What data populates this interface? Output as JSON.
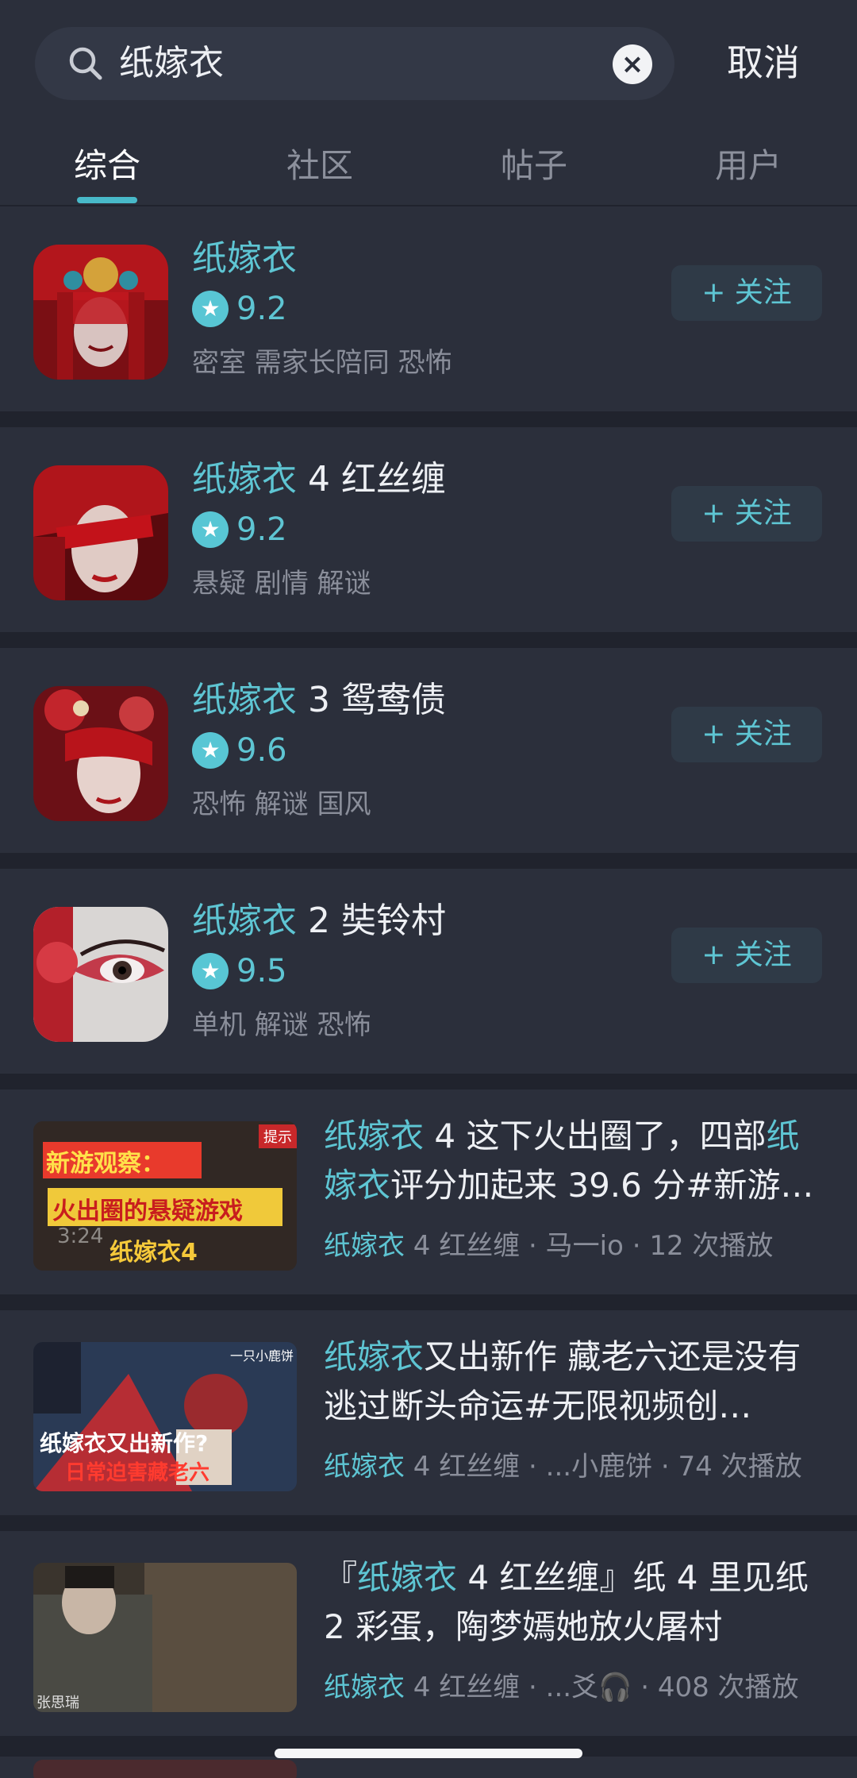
{
  "search": {
    "query": "纸嫁衣",
    "clear_icon": "close-circle-icon",
    "search_icon": "search-icon",
    "cancel_label": "取消"
  },
  "tabs": [
    {
      "label": "综合",
      "active": true
    },
    {
      "label": "社区",
      "active": false
    },
    {
      "label": "帖子",
      "active": false
    },
    {
      "label": "用户",
      "active": false
    }
  ],
  "apps": [
    {
      "title_hl": "纸嫁衣",
      "title_rest": "",
      "rating": "9.2",
      "tags": "密室 需家长陪同 恐怖",
      "follow_label": "+ 关注"
    },
    {
      "title_hl": "纸嫁衣",
      "title_rest": " 4 红丝缠",
      "rating": "9.2",
      "tags": "悬疑 剧情 解谜",
      "follow_label": "+ 关注"
    },
    {
      "title_hl": "纸嫁衣",
      "title_rest": " 3 鸳鸯债",
      "rating": "9.6",
      "tags": "恐怖 解谜 国风",
      "follow_label": "+ 关注"
    },
    {
      "title_hl": "纸嫁衣",
      "title_rest": " 2 奘铃村",
      "rating": "9.5",
      "tags": "单机 解谜 恐怖",
      "follow_label": "+ 关注"
    }
  ],
  "videos": [
    {
      "title_parts": [
        {
          "t": "纸嫁衣",
          "hl": true
        },
        {
          "t": " 4 这下火出圈了，四部",
          "hl": false
        },
        {
          "t": "纸嫁衣",
          "hl": true
        },
        {
          "t": "评分加起来 39.6 分#新游…",
          "hl": false
        }
      ],
      "meta_hl": "纸嫁衣",
      "meta_rest": " 4 红丝缠 · 马一io · 12 次播放",
      "thumb_text": [
        "新游观察：",
        "火出圈的悬疑游戏",
        "纸嫁衣4"
      ],
      "thumb_corner": "提示",
      "thumb_time": "3:24"
    },
    {
      "title_parts": [
        {
          "t": "纸嫁衣",
          "hl": true
        },
        {
          "t": "又出新作 藏老六还是没有逃过断头命运#无限视频创…",
          "hl": false
        }
      ],
      "meta_hl": "纸嫁衣",
      "meta_rest": " 4 红丝缠 · ...小鹿饼 · 74 次播放",
      "thumb_text": [
        "纸嫁衣又出新作?",
        "日常迫害藏老六"
      ],
      "thumb_corner": "一只小鹿饼"
    },
    {
      "title_parts": [
        {
          "t": "『",
          "hl": false
        },
        {
          "t": "纸嫁衣",
          "hl": true
        },
        {
          "t": " 4 红丝缠』纸 4 里见纸 2 彩蛋，陶梦嫣她放火屠村",
          "hl": false
        }
      ],
      "meta_hl": "纸嫁衣",
      "meta_rest": " 4 红丝缠 · ...爻🎧 · 408 次播放",
      "thumb_text": [
        "张思瑞"
      ]
    }
  ],
  "colors": {
    "accent": "#5ec5d3",
    "background": "#262a36",
    "card": "#2b2f3b"
  }
}
